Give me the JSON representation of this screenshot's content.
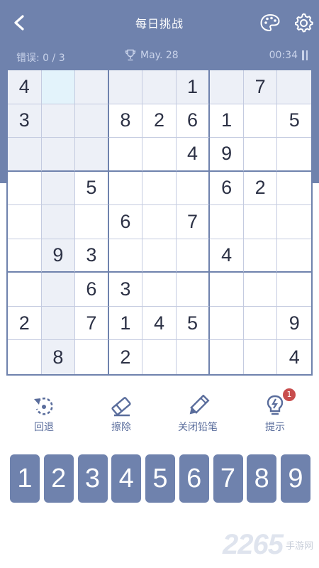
{
  "header": {
    "title": "每日挑战",
    "back_icon": "chevron-left-icon",
    "theme_icon": "palette-icon",
    "settings_icon": "gear-icon"
  },
  "status": {
    "errors": "错误: 0 / 3",
    "date": "May. 28",
    "timer": "00:34",
    "trophy_icon": "trophy-icon",
    "pause_icon": "pause-icon"
  },
  "board": {
    "grid": [
      [
        "4",
        "",
        "",
        "",
        "",
        "1",
        "",
        "7",
        ""
      ],
      [
        "3",
        "",
        "",
        "8",
        "2",
        "6",
        "1",
        "",
        "5"
      ],
      [
        "",
        "",
        "",
        "",
        "",
        "4",
        "9",
        "",
        ""
      ],
      [
        "",
        "",
        "5",
        "",
        "",
        "",
        "6",
        "2",
        ""
      ],
      [
        "",
        "",
        "",
        "6",
        "",
        "7",
        "",
        "",
        ""
      ],
      [
        "",
        "9",
        "3",
        "",
        "",
        "",
        "4",
        "",
        ""
      ],
      [
        "",
        "",
        "6",
        "3",
        "",
        "",
        "",
        "",
        ""
      ],
      [
        "2",
        "",
        "7",
        "1",
        "4",
        "5",
        "",
        "",
        "9"
      ],
      [
        "",
        "8",
        "",
        "2",
        "",
        "",
        "",
        "",
        "4"
      ]
    ],
    "selected": {
      "row": 0,
      "col": 1
    },
    "colors": {
      "accent": "#6f82ad",
      "highlight": "#edf0f7",
      "selected": "#e3f3fb",
      "digit": "#2c3145"
    }
  },
  "tools": {
    "undo": {
      "label": "回退",
      "icon": "undo-icon"
    },
    "erase": {
      "label": "擦除",
      "icon": "eraser-icon"
    },
    "pencil": {
      "label": "关闭铅笔",
      "icon": "pencil-icon"
    },
    "hint": {
      "label": "提示",
      "icon": "lightbulb-icon",
      "badge": "1"
    }
  },
  "numpad": {
    "keys": [
      "1",
      "2",
      "3",
      "4",
      "5",
      "6",
      "7",
      "8",
      "9"
    ]
  },
  "watermark": {
    "number": "2265",
    "text": "手游网"
  }
}
